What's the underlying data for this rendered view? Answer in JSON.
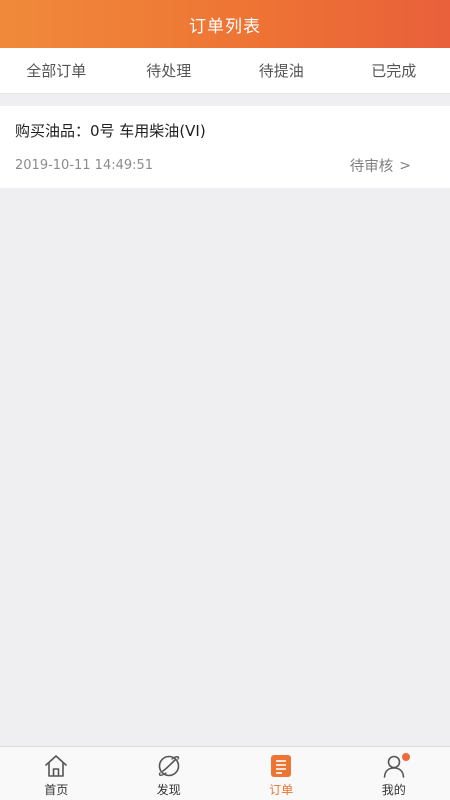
{
  "header": {
    "title": "订单列表"
  },
  "tabs": [
    {
      "label": "全部订单"
    },
    {
      "label": "待处理"
    },
    {
      "label": "待提油"
    },
    {
      "label": "已完成"
    }
  ],
  "orders": [
    {
      "title": "购买油品：0号 车用柴油(VI)",
      "time": "2019-10-11 14:49:51",
      "status": "待审核",
      "arrow": ">"
    }
  ],
  "tabbar": {
    "items": [
      {
        "label": "首页",
        "icon": "home-icon"
      },
      {
        "label": "发现",
        "icon": "planet-icon"
      },
      {
        "label": "订单",
        "icon": "order-list-icon",
        "active": true
      },
      {
        "label": "我的",
        "icon": "user-icon",
        "badge": true
      }
    ]
  },
  "colors": {
    "accent": "#ee7434",
    "background": "#efeff2"
  }
}
